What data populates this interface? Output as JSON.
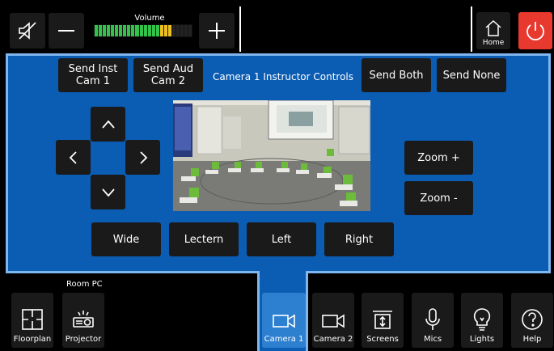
{
  "top": {
    "volume_label": "Volume",
    "volume_level": 0.78,
    "home_label": "Home"
  },
  "camera_panel": {
    "title": "Camera 1 Instructor Controls",
    "send_inst": "Send Inst\nCam 1",
    "send_aud": "Send Aud\nCam 2",
    "send_both": "Send Both",
    "send_none": "Send None",
    "zoom_in": "Zoom +",
    "zoom_out": "Zoom -",
    "presets": [
      "Wide",
      "Lectern",
      "Left",
      "Right"
    ]
  },
  "bottom": {
    "room_pc_label": "Room PC",
    "floorplan_label": "Floorplan",
    "projector_label": "Projector",
    "nav": [
      "Camera 1",
      "Camera 2",
      "Screens",
      "Mics",
      "Lights",
      "Help"
    ],
    "active_nav": "Camera 1"
  },
  "colors": {
    "panel_blue": "#0b5cb3",
    "panel_border": "#7fb6ee",
    "power_red": "#e8392f",
    "active_nav": "#2d7fd0",
    "meter_green": "#33c24a",
    "meter_yellow": "#f0c020"
  }
}
